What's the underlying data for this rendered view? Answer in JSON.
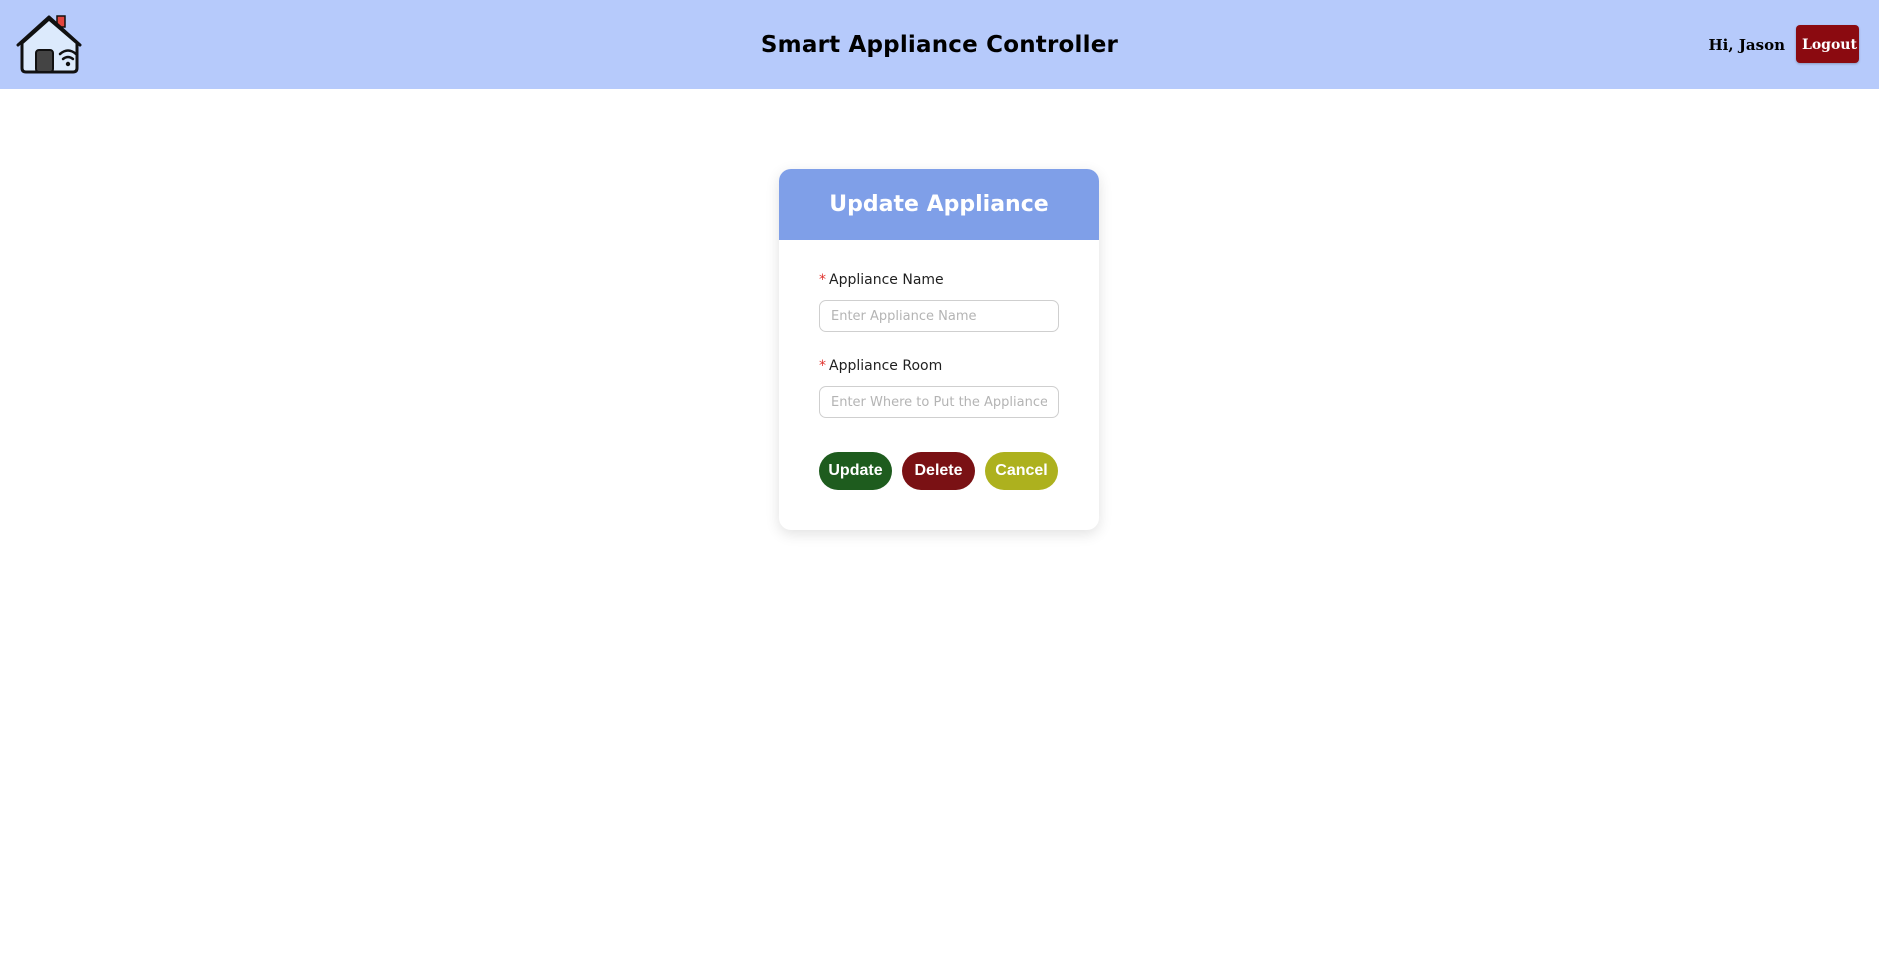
{
  "header": {
    "title": "Smart Appliance Controller",
    "greeting": "Hi, Jason",
    "logout_label": "Logout",
    "logo_icon": "smart-home-wifi-icon"
  },
  "form": {
    "title": "Update Appliance",
    "required_marker": "*",
    "name_label": "Appliance Name",
    "name_value": "",
    "name_placeholder": "Enter Appliance Name",
    "room_label": "Appliance Room",
    "room_value": "",
    "room_placeholder": "Enter Where to Put the Appliance",
    "update_label": "Update",
    "delete_label": "Delete",
    "cancel_label": "Cancel"
  },
  "colors": {
    "header_bg": "#b6cafb",
    "card_header_bg": "#7f9fe8",
    "logout_bg": "#8b0a10",
    "update_bg": "#1e5c1e",
    "delete_bg": "#7a1114",
    "cancel_bg": "#adb11e",
    "required_marker": "#e0312c"
  }
}
